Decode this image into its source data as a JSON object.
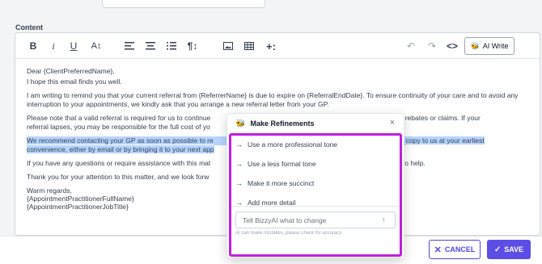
{
  "content_label": "Content",
  "toolbar": {
    "bold": "B",
    "italic": "i",
    "underline": "U",
    "font_size": "A↕",
    "ai_write_label": "AI Write"
  },
  "email": {
    "greeting": "Dear {ClientPreferredName},",
    "line1": "I hope this email finds you well.",
    "para1": "I am writing to remind you that your current referral from {ReferrerName} is due to expire on {ReferralEndDate}. To ensure continuity of your care and to avoid any interruption to your appointments, we kindly ask that you arrange a new referral letter from your GP.",
    "para2a": "Please note that a valid referral is required for us to continue",
    "para2b": "vant rebates or claims. If your",
    "para2c": "referral lapses, you may be responsible for the full cost of yo",
    "para3a": "We recommend contacting your GP as soon as possible to re",
    "para3b": "copy to us at your earliest",
    "para3c": "convenience, either by email or by bringing it to your next app",
    "para4a": "If you have any questions or require assistance with this mat",
    "para4b": "o help.",
    "para5": "Thank you for your attention to this matter, and we look forw",
    "signoff": "Warm regards,",
    "sig_name": "{AppointmentPractitionerFullName}",
    "sig_title": "{AppointmentPractitionerJobTitle}"
  },
  "popup": {
    "title": "Make Refinements",
    "close": "×",
    "options": [
      "Use a more professional tone",
      "Use a less formal tone",
      "Make it more succinct",
      "Add more detail"
    ],
    "input_placeholder": "Tell BizzyAI what to change",
    "disclaimer": "AI can make mistakes, please check for accuracy"
  },
  "footer": {
    "cancel_label": "CANCEL",
    "save_label": "SAVE"
  },
  "colors": {
    "accent": "#5b4ee6",
    "highlight_border": "#c21ee0",
    "selection": "#b6d4fe"
  }
}
